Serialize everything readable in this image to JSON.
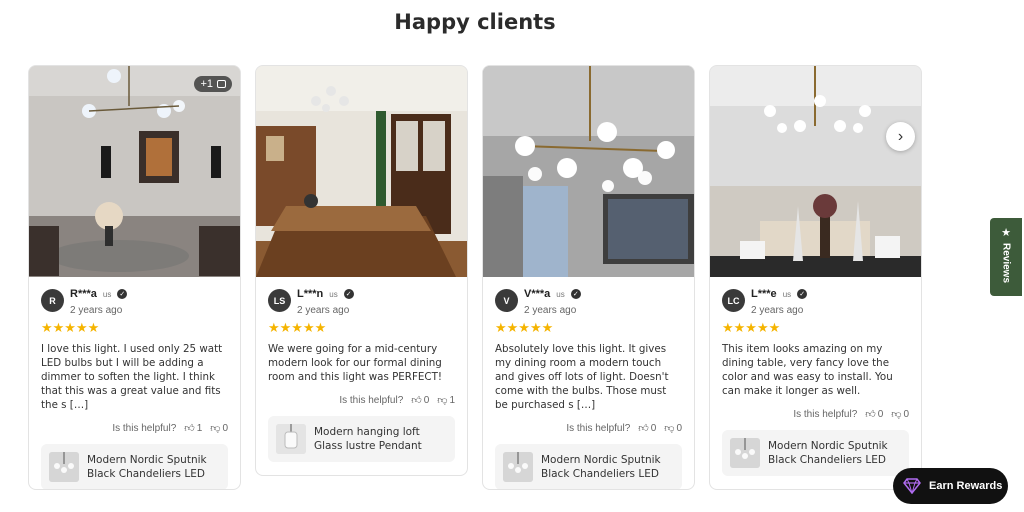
{
  "section": {
    "title": "Happy clients"
  },
  "cards": [
    {
      "initials": "R",
      "name": "R***a",
      "country": "us",
      "date": "2 years ago",
      "stars": "★★★★★",
      "text": "I love this light. I used only 25 watt LED bulbs but I will be adding a dimmer to soften the light. I think that this was a great value and fits the s […]",
      "helpful_label": "Is this helpful?",
      "up": "1",
      "down": "0",
      "product": "Modern Nordic Sputnik Black Chandeliers LED",
      "more_photos": "+1"
    },
    {
      "initials": "LS",
      "name": "L***n",
      "country": "us",
      "date": "2 years ago",
      "stars": "★★★★★",
      "text": "We were going for a mid-century modern look for our formal dining room and this light was PERFECT!",
      "helpful_label": "Is this helpful?",
      "up": "0",
      "down": "1",
      "product": "Modern hanging loft Glass lustre Pendant"
    },
    {
      "initials": "V",
      "name": "V***a",
      "country": "us",
      "date": "2 years ago",
      "stars": "★★★★★",
      "text": "Absolutely love this light. It gives my dining room a modern touch and gives off lots of light. Doesn't come with the bulbs. Those must be purchased s […]",
      "helpful_label": "Is this helpful?",
      "up": "0",
      "down": "0",
      "product": "Modern Nordic Sputnik Black Chandeliers LED"
    },
    {
      "initials": "LC",
      "name": "L***e",
      "country": "us",
      "date": "2 years ago",
      "stars": "★★★★★",
      "text": "This item looks amazing on my dining table, very fancy love the color and was easy to install. You can make it longer as well.",
      "helpful_label": "Is this helpful?",
      "up": "0",
      "down": "0",
      "product": "Modern Nordic Sputnik Black Chandeliers LED"
    }
  ],
  "reviews_tab": {
    "label": "Reviews",
    "icon": "star-icon"
  },
  "rewards": {
    "label": "Earn Rewards",
    "icon": "diamond-icon",
    "accent": "#b06cf0"
  },
  "colors": {
    "star": "#f5b400",
    "tab": "#3d5b3a",
    "rewards_bg": "#111111"
  }
}
